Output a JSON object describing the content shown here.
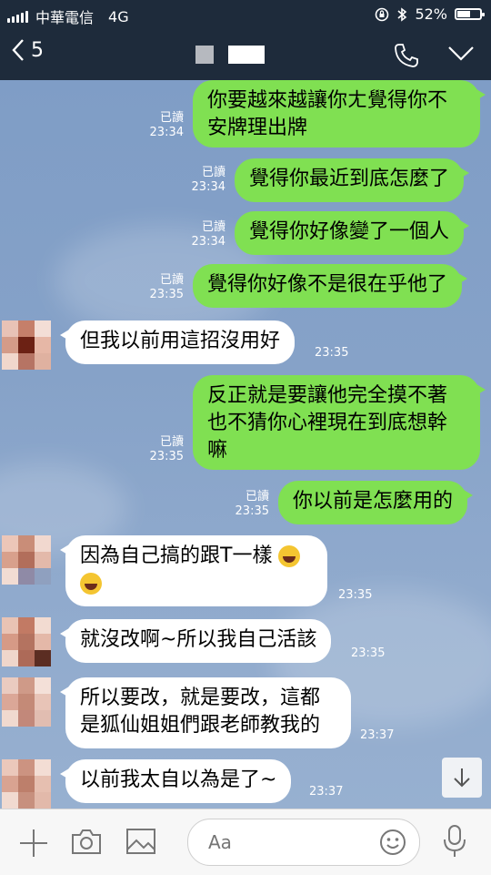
{
  "status_bar": {
    "carrier": "中華電信",
    "network": "4G",
    "battery_pct": "52%",
    "battery_level": 0.52
  },
  "header": {
    "back_count": "5"
  },
  "messages": [
    {
      "side": "out",
      "read": "已讀",
      "time": "23:34",
      "text": "你要越來越讓你ㄤ覺得你不安牌理出牌"
    },
    {
      "side": "out",
      "read": "已讀",
      "time": "23:34",
      "text": "覺得你最近到底怎麼了"
    },
    {
      "side": "out",
      "read": "已讀",
      "time": "23:34",
      "text": "覺得你好像變了一個人"
    },
    {
      "side": "out",
      "read": "已讀",
      "time": "23:35",
      "text": "覺得你好像不是很在乎他了"
    },
    {
      "side": "in",
      "time": "23:35",
      "text": "但我以前用這招沒用好"
    },
    {
      "side": "out",
      "read": "已讀",
      "time": "23:35",
      "text": "反正就是要讓他完全摸不著也不猜你心裡現在到底想幹嘛"
    },
    {
      "side": "out",
      "read": "已讀",
      "time": "23:35",
      "text": "你以前是怎麼用的"
    },
    {
      "side": "in",
      "time": "23:35",
      "text": "因為自己搞的跟T一樣"
    },
    {
      "side": "in",
      "time": "23:35",
      "text": "就沒改啊~所以我自己活該"
    },
    {
      "side": "in",
      "time": "23:37",
      "text": "所以要改，就是要改，這都是狐仙姐姐們跟老師教我的"
    },
    {
      "side": "in",
      "time": "23:37",
      "text": "以前我太自以為是了~"
    }
  ],
  "input": {
    "placeholder": "Aa"
  },
  "colors": {
    "bubble_out": "#80e052",
    "bubble_in": "#ffffff",
    "header_bg": "#1e2b3b",
    "chat_bg": "#7f9cc5"
  },
  "icons": [
    "back-chevron-icon",
    "phone-icon",
    "chevron-down-icon",
    "plus-icon",
    "camera-icon",
    "image-icon",
    "emoji-icon",
    "microphone-icon",
    "arrow-down-icon"
  ]
}
